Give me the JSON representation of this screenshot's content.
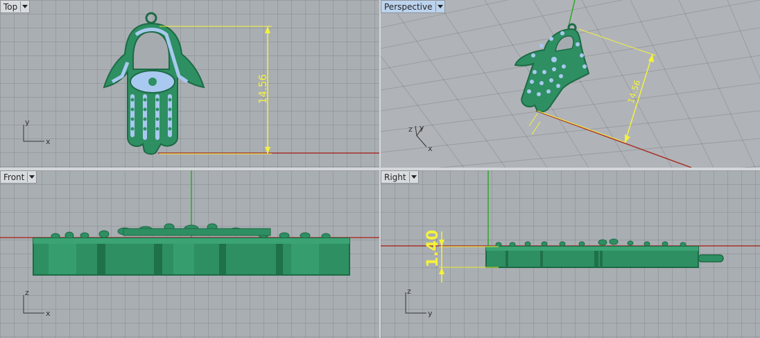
{
  "viewports": {
    "top": {
      "title": "Top"
    },
    "perspective": {
      "title": "Perspective"
    },
    "front": {
      "title": "Front"
    },
    "right": {
      "title": "Right"
    }
  },
  "dimensions": {
    "height": "14.56",
    "thickness": "1.40"
  },
  "axes": {
    "top": {
      "a": "y",
      "b": "x"
    },
    "persp": {
      "a": "z",
      "b": "y",
      "c": "x"
    },
    "front": {
      "a": "z",
      "b": "x"
    },
    "right": {
      "a": "z",
      "b": "y"
    }
  },
  "colors": {
    "model": "#2e8f62",
    "model_dark": "#1d6a45",
    "stones": "#a9c9f0",
    "dimension": "#f5f23a",
    "x_axis": "#a8322a",
    "y_axis": "#2aa82a"
  }
}
